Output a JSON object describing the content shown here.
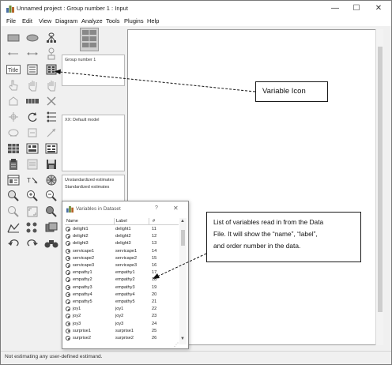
{
  "window": {
    "title": "Unnamed project : Group number 1 : Input",
    "minimize": "—",
    "maximize": "☐",
    "close": "✕"
  },
  "menu": [
    "File",
    "Edit",
    "View",
    "Diagram",
    "Analyze",
    "Tools",
    "Plugins",
    "Help"
  ],
  "panels": {
    "groups": "Group number 1",
    "models": "XX: Default model",
    "estimates_1": "Unstandardized estimates",
    "estimates_2": "Standardized estimates"
  },
  "toolbox": {
    "title_tool": "Title"
  },
  "callouts": {
    "variable_icon": "Variable Icon",
    "variable_list_1": "List of variables read in from the Data",
    "variable_list_2": "File. It will show the “name”, “label”,",
    "variable_list_3": "and order number in the data."
  },
  "dialog": {
    "title": "Variables in Dataset",
    "help": "?",
    "close": "✕",
    "columns": [
      "Name",
      "Label",
      "#"
    ],
    "rows": [
      {
        "name": "delight1",
        "label": "delight1",
        "num": "11"
      },
      {
        "name": "delight2",
        "label": "delight2",
        "num": "12"
      },
      {
        "name": "delight3",
        "label": "delight3",
        "num": "13"
      },
      {
        "name": "servicape1",
        "label": "servicape1",
        "num": "14"
      },
      {
        "name": "servicape2",
        "label": "servicape2",
        "num": "15"
      },
      {
        "name": "servicape3",
        "label": "servicape3",
        "num": "16"
      },
      {
        "name": "empathy1",
        "label": "empathy1",
        "num": "17"
      },
      {
        "name": "empathy2",
        "label": "empathy2",
        "num": "18"
      },
      {
        "name": "empathy3",
        "label": "empathy3",
        "num": "19"
      },
      {
        "name": "empathy4",
        "label": "empathy4",
        "num": "20"
      },
      {
        "name": "empathy5",
        "label": "empathy5",
        "num": "21"
      },
      {
        "name": "joy1",
        "label": "joy1",
        "num": "22"
      },
      {
        "name": "joy2",
        "label": "joy2",
        "num": "23"
      },
      {
        "name": "joy3",
        "label": "joy3",
        "num": "24"
      },
      {
        "name": "surprise1",
        "label": "surprise1",
        "num": "25"
      },
      {
        "name": "surprise2",
        "label": "surprise2",
        "num": "26"
      }
    ]
  },
  "status": "Not estimating any user-defined estimand.",
  "colors": {
    "chrome": "#f0f0f0",
    "canvas": "#ffffff",
    "callout_border": "#1a1a1a"
  }
}
